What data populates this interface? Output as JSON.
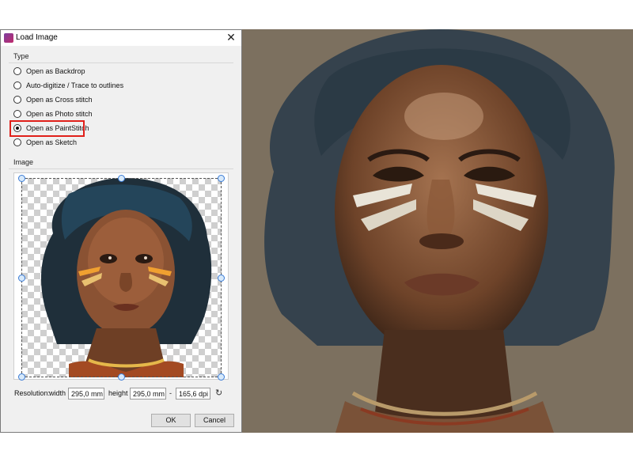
{
  "dialog": {
    "title": "Load Image",
    "close_glyph": "✕",
    "type_section": "Type",
    "options": [
      {
        "label": "Open as Backdrop",
        "checked": false
      },
      {
        "label": "Auto-digitize / Trace to outlines",
        "checked": false
      },
      {
        "label": "Open as Cross stitch",
        "checked": false
      },
      {
        "label": "Open as Photo stitch",
        "checked": false
      },
      {
        "label": "Open as PaintStitch",
        "checked": true
      },
      {
        "label": "Open as Sketch",
        "checked": false
      }
    ],
    "image_section": "Image",
    "resolution": {
      "label": "Resolution:",
      "width_label": "width",
      "width_value": "295,0 mm",
      "height_label": "height",
      "height_value": "295,0 mm",
      "separator": "-",
      "dpi_value": "165,6 dpi"
    },
    "ok_label": "OK",
    "cancel_label": "Cancel"
  },
  "icons": {
    "app": "app-icon",
    "close": "close-icon",
    "reset": "reset-icon"
  },
  "colors": {
    "highlight": "#e0201a",
    "background_canvas": "#7c705f"
  }
}
